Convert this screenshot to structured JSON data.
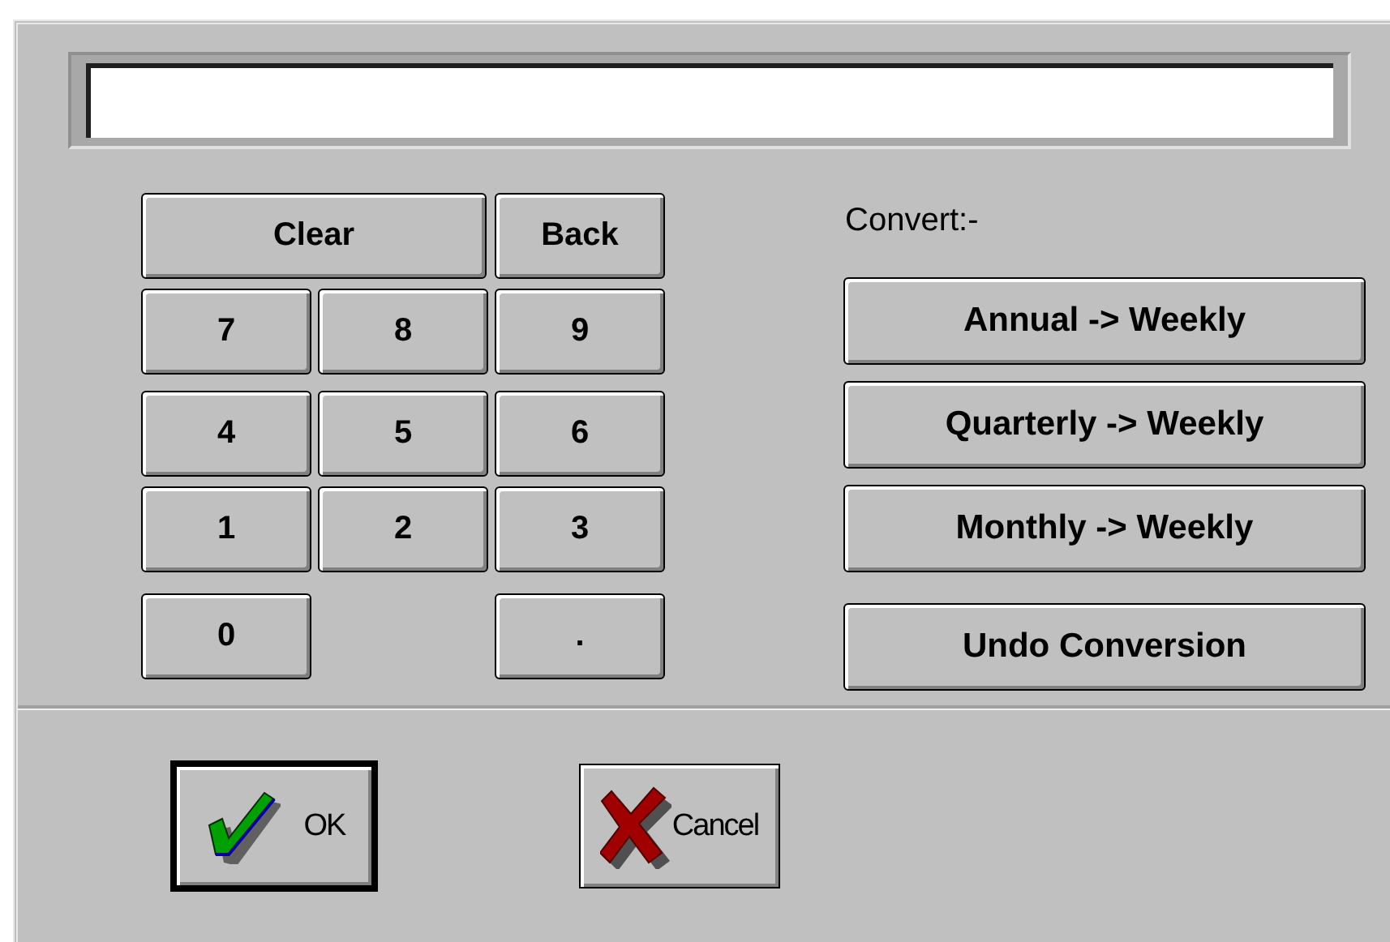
{
  "keypad": {
    "rows": [
      [
        {
          "label": "Clear",
          "kind": "wide"
        },
        {
          "label": "Back",
          "kind": "key"
        }
      ],
      [
        {
          "label": "7",
          "kind": "key"
        },
        {
          "label": "8",
          "kind": "key"
        },
        {
          "label": "9",
          "kind": "key"
        }
      ],
      [
        {
          "label": "4",
          "kind": "key"
        },
        {
          "label": "5",
          "kind": "key"
        },
        {
          "label": "6",
          "kind": "key"
        }
      ],
      [
        {
          "label": "1",
          "kind": "key"
        },
        {
          "label": "2",
          "kind": "key"
        },
        {
          "label": "3",
          "kind": "key"
        }
      ],
      [
        {
          "label": "0",
          "kind": "key"
        },
        {
          "label": ".",
          "kind": "key"
        }
      ]
    ]
  },
  "convert": {
    "label": "Convert:-",
    "buttons": [
      "Annual -> Weekly",
      "Quarterly -> Weekly",
      "Monthly -> Weekly",
      "Undo Conversion"
    ]
  },
  "actions": [
    {
      "label": "OK",
      "kind": "ok",
      "default": true
    },
    {
      "label": "Cancel",
      "kind": "cancel",
      "default": false
    }
  ]
}
